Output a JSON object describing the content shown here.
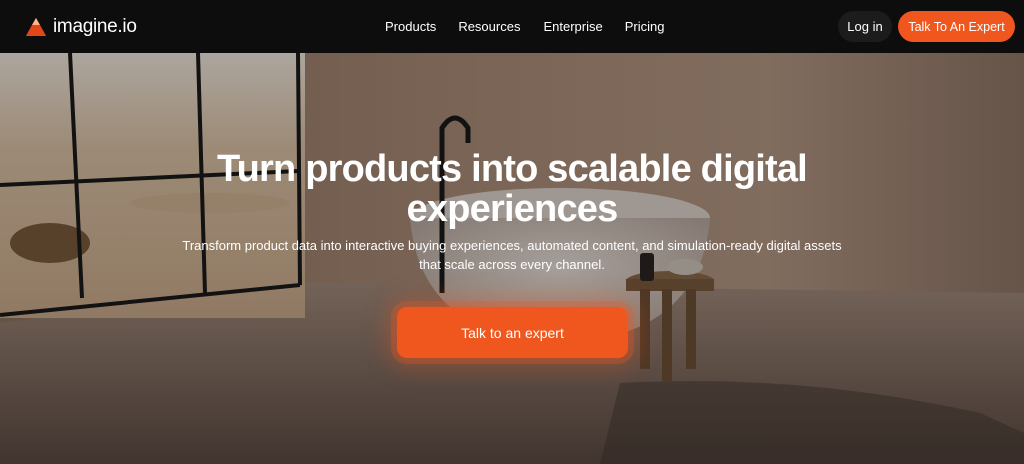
{
  "brand": {
    "name": "imagine.io",
    "accent": "#f0571e"
  },
  "nav": {
    "links": [
      "Products",
      "Resources",
      "Enterprise",
      "Pricing"
    ],
    "login": "Log in",
    "cta": "Talk To An Expert"
  },
  "hero": {
    "title": "Turn products into scalable digital experiences",
    "subtitle": "Transform product data into interactive buying experiences, automated content, and simulation-ready digital assets that scale across every channel.",
    "cta": "Talk to an expert"
  },
  "icons": {
    "logo": "triangle-logo-icon"
  }
}
